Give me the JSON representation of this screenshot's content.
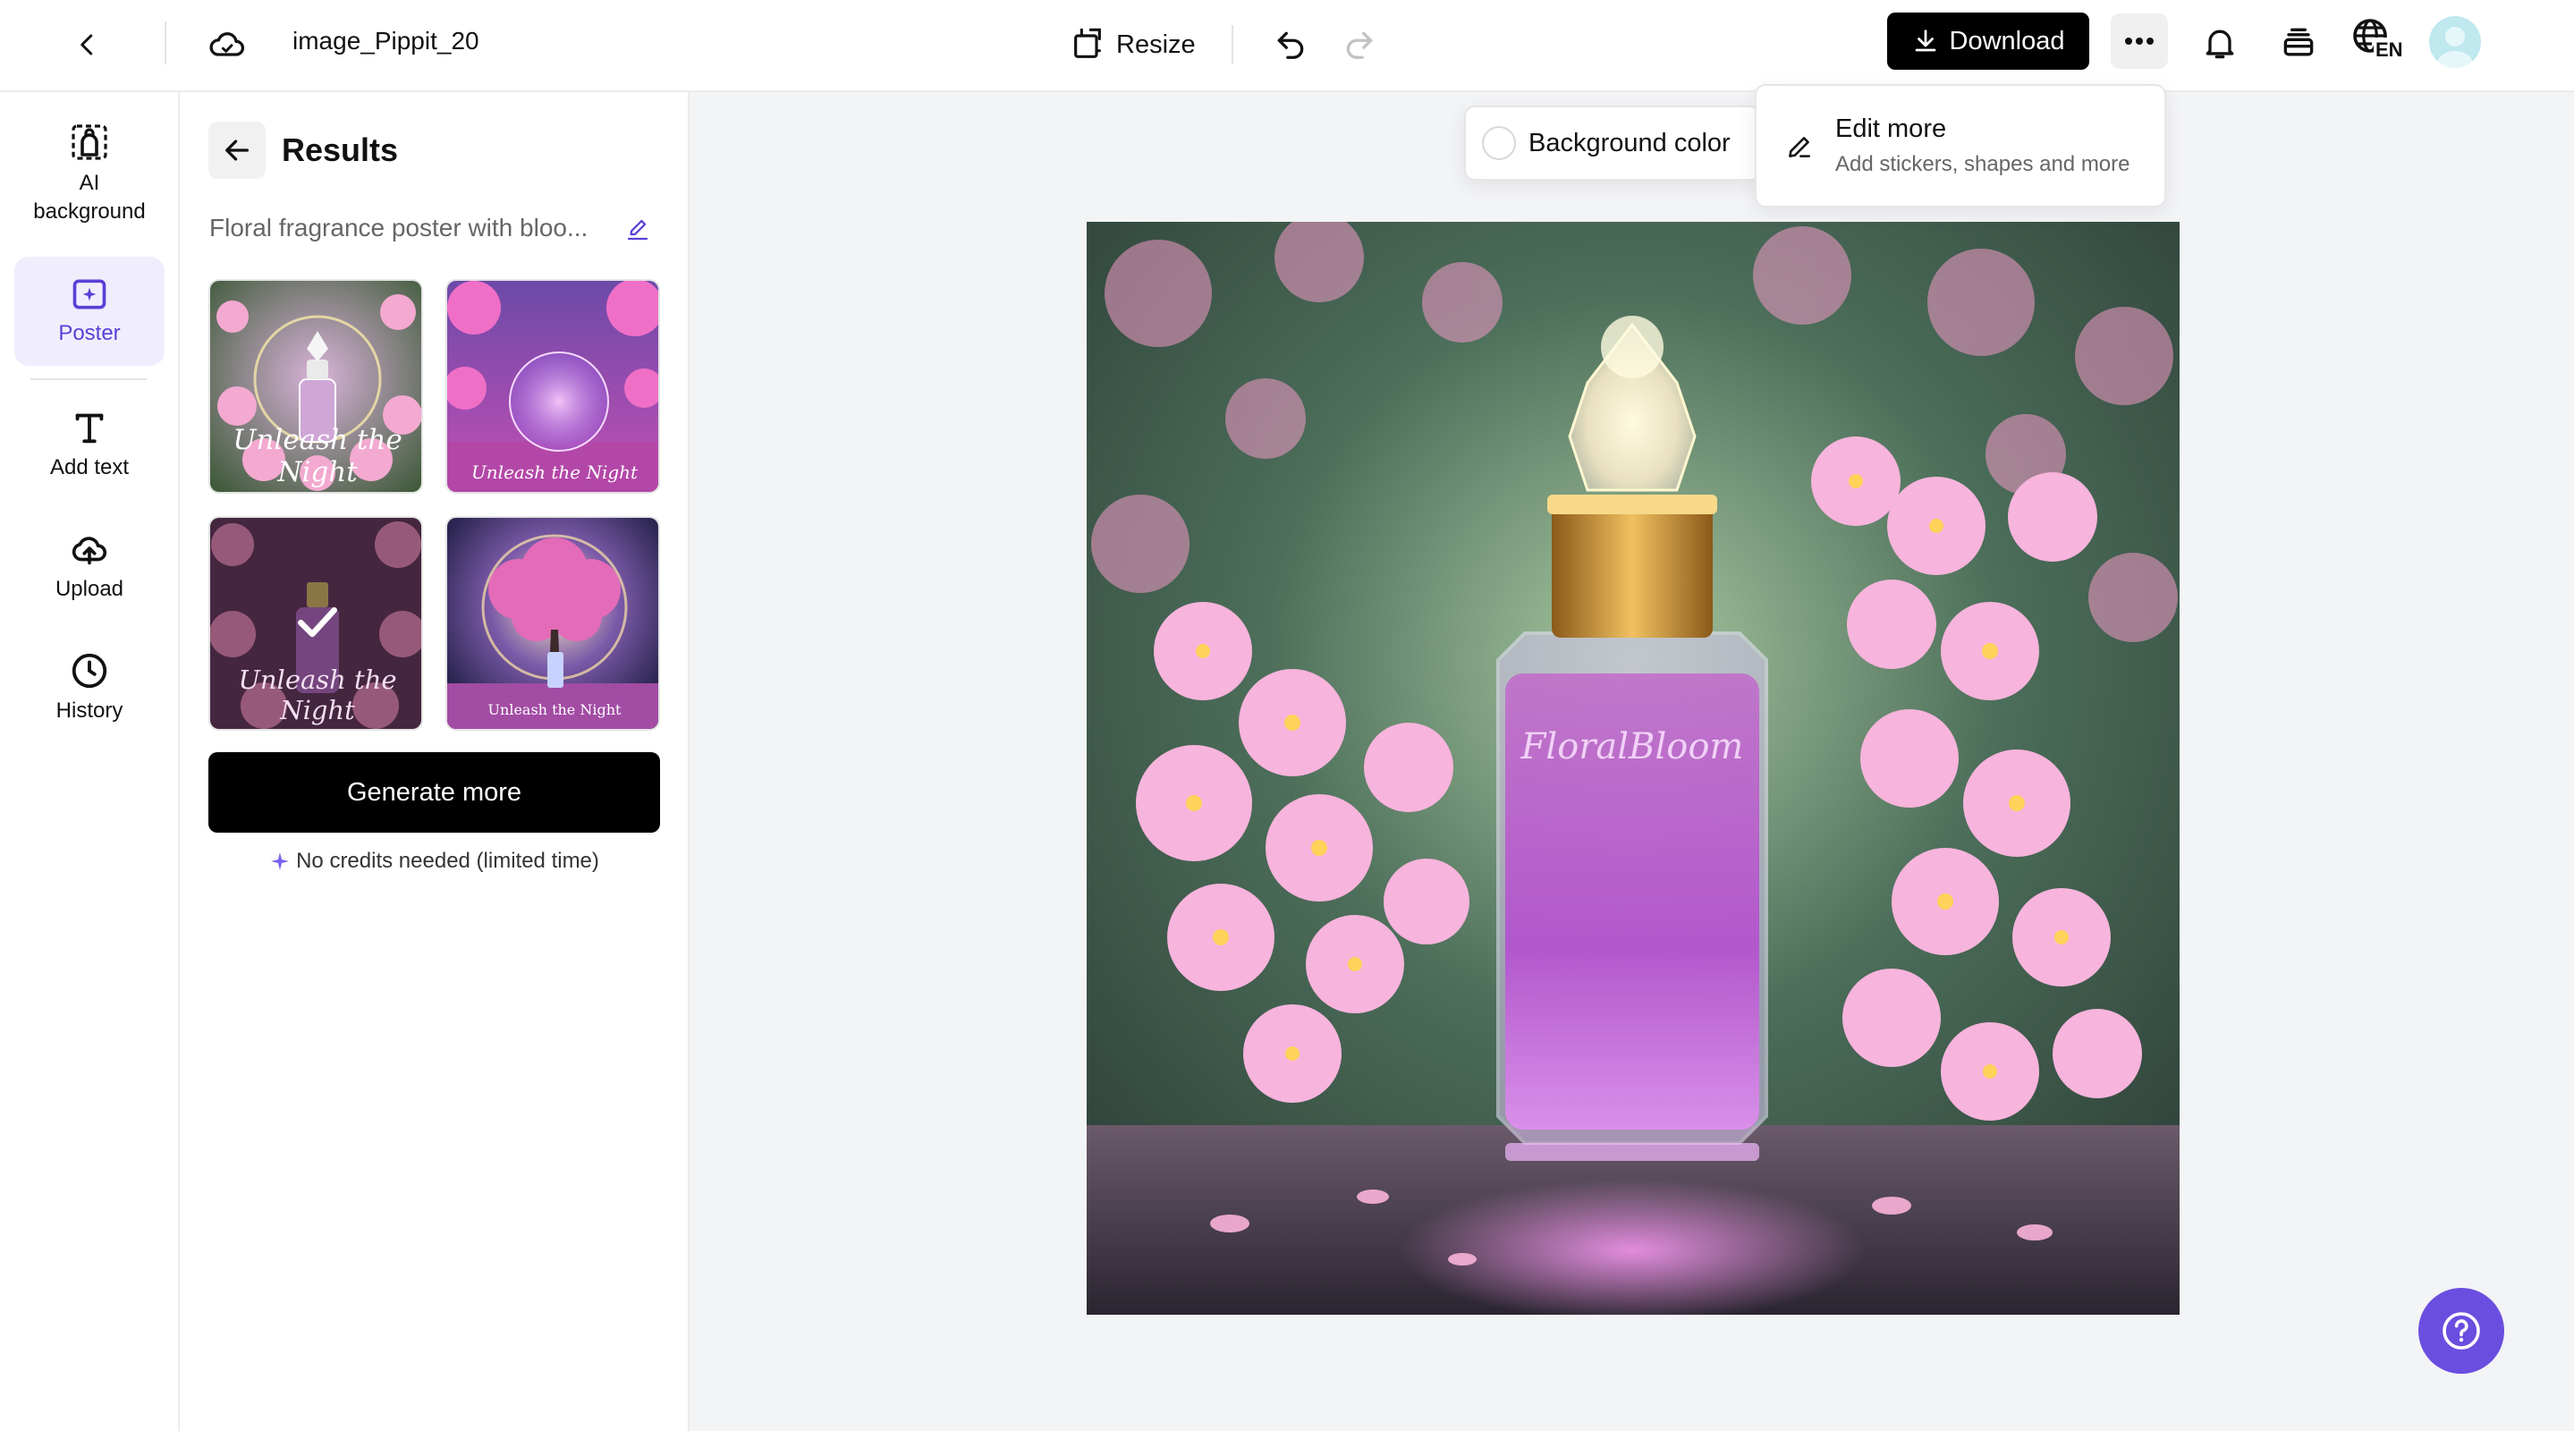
{
  "topbar": {
    "filename": "image_Pippit_20",
    "resize_label": "Resize",
    "download_label": "Download",
    "language_badge": "EN"
  },
  "leftnav": {
    "items": [
      {
        "label": "AI background",
        "icon": "ai-background-icon"
      },
      {
        "label": "Poster",
        "icon": "poster-icon",
        "active": true
      },
      {
        "label": "Add text",
        "icon": "text-icon"
      },
      {
        "label": "Upload",
        "icon": "upload-cloud-icon"
      },
      {
        "label": "History",
        "icon": "clock-icon"
      }
    ]
  },
  "panel": {
    "title": "Results",
    "prompt": "Floral fragrance poster with bloo...",
    "results": [
      {
        "caption": "Unleash the Night",
        "selected": false
      },
      {
        "caption": "Unleash the Night",
        "selected": false
      },
      {
        "caption": "Unleash the Night",
        "selected": true
      },
      {
        "caption": "Unleash the Night",
        "selected": false
      }
    ],
    "generate_label": "Generate more",
    "credits_note": "No credits needed (limited time)"
  },
  "canvas": {
    "background_color_label": "Background color",
    "bottle_label": "FloralBloom"
  },
  "menu": {
    "edit_more_title": "Edit more",
    "edit_more_sub": "Add stickers, shapes and more"
  },
  "colors": {
    "accent": "#5b3fd6",
    "help_button": "#6a4ee0",
    "download_bg": "#000000"
  }
}
